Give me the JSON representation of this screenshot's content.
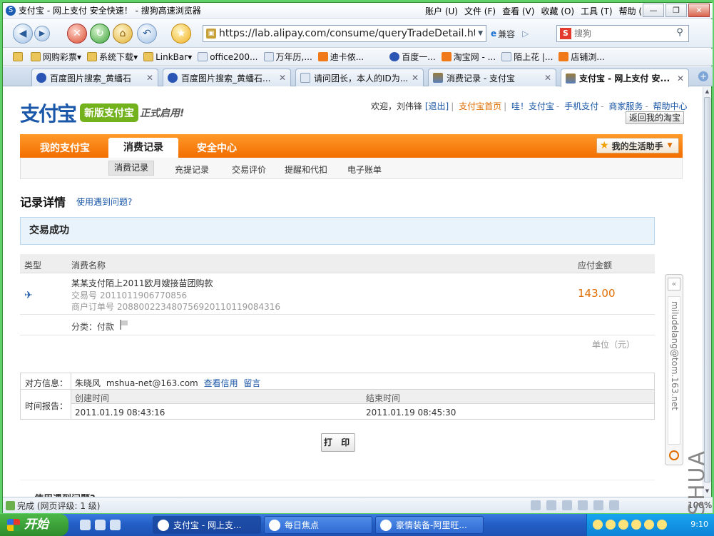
{
  "window": {
    "title": "支付宝 - 网上支付 安全快速！ - 搜狗高速浏览器",
    "menu": [
      "账户 (U)",
      "文件 (F)",
      "查看 (V)",
      "收藏 (O)",
      "工具 (T)",
      "帮助 (H)"
    ]
  },
  "toolbar": {
    "url": "https://lab.alipay.com/consume/queryTradeDetail.htm",
    "compat_label": "兼容",
    "search_placeholder": "搜狗"
  },
  "favorites": [
    "网购彩票",
    "系统下载",
    "LinkBar",
    "office200...",
    "万年历,...",
    "迪卡侬...",
    "百度一...",
    "淘宝网 - ...",
    "陌上花 |...",
    "店铺浏..."
  ],
  "tabs": [
    {
      "label": "百度图片搜索_黄蟠石",
      "icon": "paw-icon"
    },
    {
      "label": "百度图片搜索_黄蟠石...",
      "icon": "paw-icon"
    },
    {
      "label": "请问团长，本人的ID为...",
      "icon": "page-icon"
    },
    {
      "label": "消费记录 - 支付宝",
      "icon": "shield-icon"
    },
    {
      "label": "支付宝 - 网上支付 安...",
      "icon": "shield-icon",
      "active": true
    }
  ],
  "site": {
    "logo_text": "支付宝",
    "logo_badge": "新版支付宝",
    "logo_tag": "正式启用!",
    "welcome": "欢迎，刘伟锋",
    "logout": "[退出]",
    "links": [
      "支付宝首页",
      "哇！支付宝",
      "手机支付",
      "商家服务",
      "帮助中心"
    ],
    "back_taobao": "返回我的淘宝",
    "main_nav": [
      "我的支付宝",
      "消费记录",
      "安全中心"
    ],
    "helper": "我的生活助手",
    "sub_nav": [
      "消费记录",
      "充提记录",
      "交易评价",
      "提醒和代扣",
      "电子账单"
    ]
  },
  "detail": {
    "title": "记录详情",
    "help_link": "使用遇到问题?",
    "status": "交易成功",
    "columns": [
      "类型",
      "消费名称",
      "应付金额"
    ],
    "item": {
      "name": "某某支付陌上2011欧月嫂接苗团购款",
      "trade_no_label": "交易号",
      "trade_no": "2011011906770856",
      "merchant_no_label": "商户订单号",
      "merchant_no": "208800223480756920110119084316",
      "amount": "143.00"
    },
    "category": "分类：付款",
    "unit": "单位（元）",
    "party_label": "对方信息：",
    "party_name": "朱晓风",
    "party_email": "mshua-net@163.com",
    "party_credit_link": "查看信用",
    "party_message_link": "留言",
    "time_label": "时间报告：",
    "created_label": "创建时间",
    "created_value": "2011.01.19 08:43:16",
    "ended_label": "结束时间",
    "ended_value": "2011.01.19 08:45:30",
    "print_label": "打 印",
    "faq_partial": "使用遇到问题?"
  },
  "side_widget": {
    "email": "miludelang@tom.163.net"
  },
  "watermark": "MSHUA",
  "statusbar": {
    "text": "完成 (网页评级: 1 级)",
    "zoom": "100%"
  },
  "taskbar": {
    "start": "开始",
    "tasks": [
      "支付宝 - 网上支...",
      "每日焦点",
      "豪情装备-阿里旺..."
    ],
    "clock": "9:10"
  }
}
